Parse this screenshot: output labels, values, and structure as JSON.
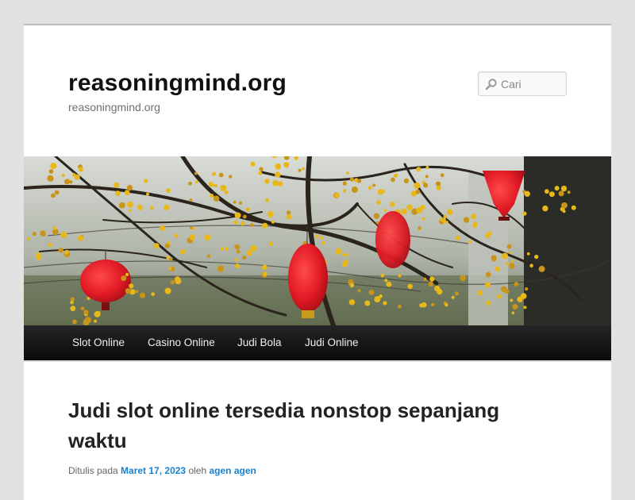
{
  "site": {
    "title": "reasoningmind.org",
    "description": "reasoningmind.org"
  },
  "search": {
    "placeholder": "Cari",
    "icon": "search-icon"
  },
  "banner": {
    "description": "red lanterns among yellow blossom branches"
  },
  "nav": {
    "items": [
      "Slot Online",
      "Casino Online",
      "Judi Bola",
      "Judi Online"
    ]
  },
  "post": {
    "title": "Judi slot online tersedia nonstop sepanjang waktu",
    "meta_prefix": "Ditulis pada",
    "date": "Maret 17, 2023",
    "by": "oleh",
    "author": "agen agen"
  },
  "colors": {
    "background": "#e2e2e2",
    "nav_bg": "#111111",
    "link": "#1982d1",
    "lantern": "#e01a24",
    "blossom": "#e8b81a"
  }
}
